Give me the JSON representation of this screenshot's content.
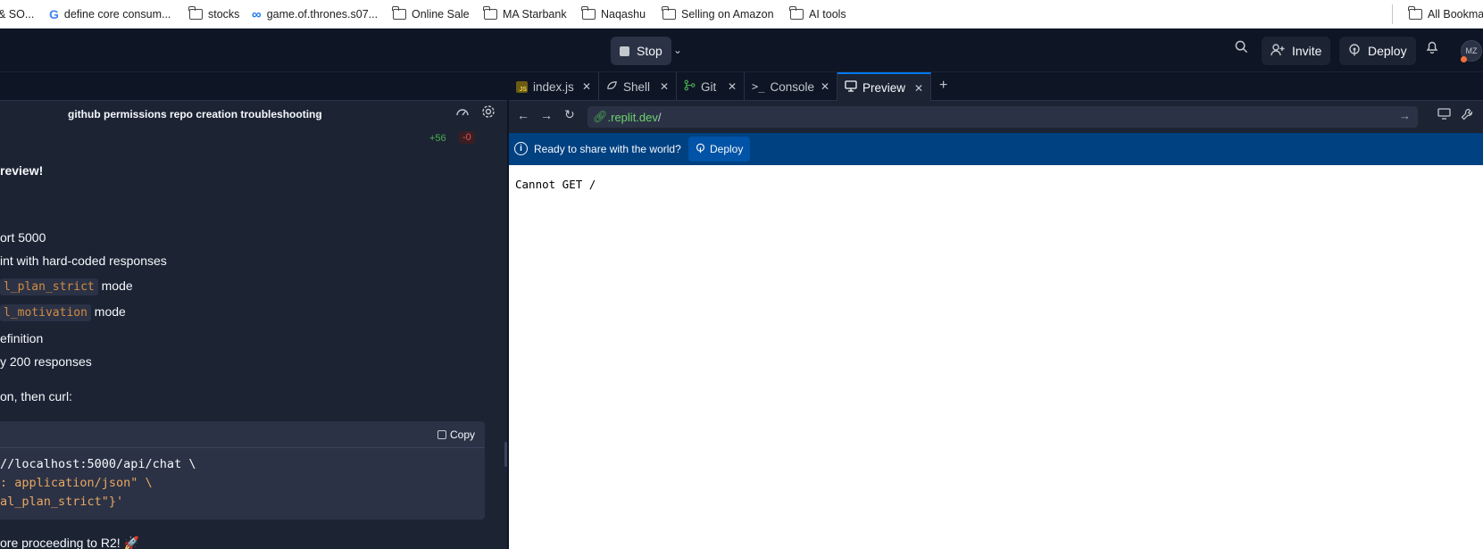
{
  "bookmarks": {
    "items": [
      {
        "label": "& SO...",
        "icon": "none"
      },
      {
        "label": "define core consum...",
        "icon": "google-icon"
      },
      {
        "label": "stocks",
        "icon": "folder-icon"
      },
      {
        "label": "game.of.thrones.s07...",
        "icon": "infinity-icon"
      },
      {
        "label": "Online Sale",
        "icon": "folder-icon"
      },
      {
        "label": "MA Starbank",
        "icon": "folder-icon"
      },
      {
        "label": "Naqashu",
        "icon": "folder-icon"
      },
      {
        "label": "Selling on Amazon",
        "icon": "folder-icon"
      },
      {
        "label": "AI tools",
        "icon": "folder-icon"
      }
    ],
    "all_bookmarks": "All Bookma"
  },
  "topbar": {
    "stop_label": "Stop",
    "invite_label": "Invite",
    "deploy_label": "Deploy",
    "avatar_initials": "MZ"
  },
  "chat": {
    "title": "github permissions repo creation troubleshooting",
    "diff_added": "+56",
    "diff_removed": "-0",
    "review_heading": "review!",
    "lines": [
      "ort 5000",
      "int with hard-coded responses"
    ],
    "mode_lines": [
      {
        "code": "l_plan_strict",
        "suffix": " mode"
      },
      {
        "code": "l_motivation",
        "suffix": " mode"
      }
    ],
    "lines2": [
      "efinition",
      "y 200 responses"
    ],
    "then_curl": "on, then curl:",
    "copy_label": "Copy",
    "code_lines": [
      {
        "text": "//localhost:5000/api/chat \\",
        "color": "white"
      },
      {
        "text": ": application/json\" \\",
        "color": "mixed"
      },
      {
        "text": "al_plan_strict\"}'",
        "color": "orange"
      }
    ],
    "footer": "ore proceeding to R2! 🚀"
  },
  "tabs": [
    {
      "label": "index.js",
      "icon": "js-file-icon",
      "active": false
    },
    {
      "label": "Shell",
      "icon": "shell-icon",
      "active": false
    },
    {
      "label": "Git",
      "icon": "git-icon",
      "active": false
    },
    {
      "label": "Console",
      "icon": "console-icon",
      "active": false
    },
    {
      "label": "Preview",
      "icon": "monitor-icon",
      "active": true
    }
  ],
  "preview": {
    "url_host": ".replit.dev",
    "url_path": "/",
    "banner_text": "Ready to share with the world?",
    "banner_button": "Deploy",
    "page_text": "Cannot GET /"
  },
  "colors": {
    "accent": "#0079f2",
    "banner_bg": "#004182",
    "ide_bg": "#0e1525",
    "panel_bg": "#1c2333"
  }
}
